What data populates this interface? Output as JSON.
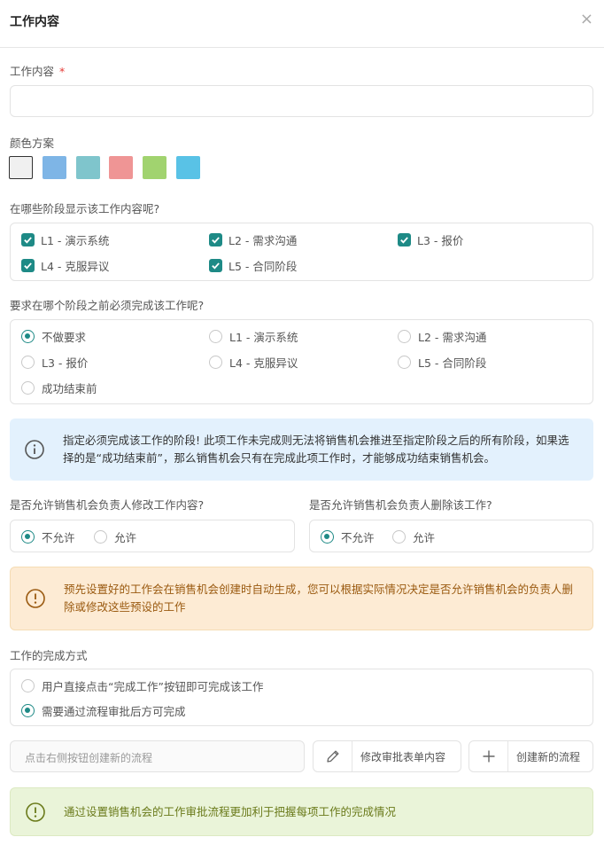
{
  "header": {
    "title": "工作内容",
    "close_glyph": "×"
  },
  "content": {
    "label": "工作内容",
    "required_mark": "*",
    "value": ""
  },
  "color_scheme": {
    "label": "颜色方案",
    "swatches": [
      "#f0f0f0",
      "#7eb5e6",
      "#7fc5cc",
      "#ef9595",
      "#a1d36f",
      "#59c2e6"
    ],
    "selected_index": 0
  },
  "show_stages": {
    "label": "在哪些阶段显示该工作内容呢?",
    "options": [
      {
        "label": "L1 - 演示系统",
        "checked": true
      },
      {
        "label": "L2 - 需求沟通",
        "checked": true
      },
      {
        "label": "L3 - 报价",
        "checked": true
      },
      {
        "label": "L4 - 克服异议",
        "checked": true
      },
      {
        "label": "L5 - 合同阶段",
        "checked": true
      }
    ]
  },
  "must_complete": {
    "label": "要求在哪个阶段之前必须完成该工作呢?",
    "options": [
      {
        "label": "不做要求",
        "selected": true
      },
      {
        "label": "L1 - 演示系统",
        "selected": false
      },
      {
        "label": "L2 - 需求沟通",
        "selected": false
      },
      {
        "label": "L3 - 报价",
        "selected": false
      },
      {
        "label": "L4 - 克服异议",
        "selected": false
      },
      {
        "label": "L5 - 合同阶段",
        "selected": false
      },
      {
        "label": "成功结束前",
        "selected": false
      }
    ]
  },
  "info_alert": {
    "icon": "info-circle-icon",
    "text": "指定必须完成该工作的阶段! 此项工作未完成则无法将销售机会推进至指定阶段之后的所有阶段，如果选择的是“成功结束前”，那么销售机会只有在完成此项工作时，才能够成功结束销售机会。"
  },
  "allow_modify": {
    "label": "是否允许销售机会负责人修改工作内容?",
    "options": [
      {
        "label": "不允许",
        "selected": true
      },
      {
        "label": "允许",
        "selected": false
      }
    ]
  },
  "allow_delete": {
    "label": "是否允许销售机会负责人删除该工作?",
    "options": [
      {
        "label": "不允许",
        "selected": true
      },
      {
        "label": "允许",
        "selected": false
      }
    ]
  },
  "warn_alert": {
    "icon": "info-circle-icon",
    "text": "预先设置好的工作会在销售机会创建时自动生成，您可以根据实际情况决定是否允许销售机会的负责人删除或修改这些预设的工作"
  },
  "completion": {
    "label": "工作的完成方式",
    "options": [
      {
        "label": "用户直接点击“完成工作”按钮即可完成该工作",
        "selected": false
      },
      {
        "label": "需要通过流程审批后方可完成",
        "selected": true
      }
    ]
  },
  "flow": {
    "placeholder": "点击右侧按钮创建新的流程",
    "edit_button": "修改审批表单内容",
    "create_button": "创建新的流程"
  },
  "success_alert": {
    "icon": "info-circle-icon",
    "text": "通过设置销售机会的工作审批流程更加利于把握每项工作的完成情况"
  },
  "colors": {
    "accent": "#1e8a86",
    "required": "#e53935"
  }
}
